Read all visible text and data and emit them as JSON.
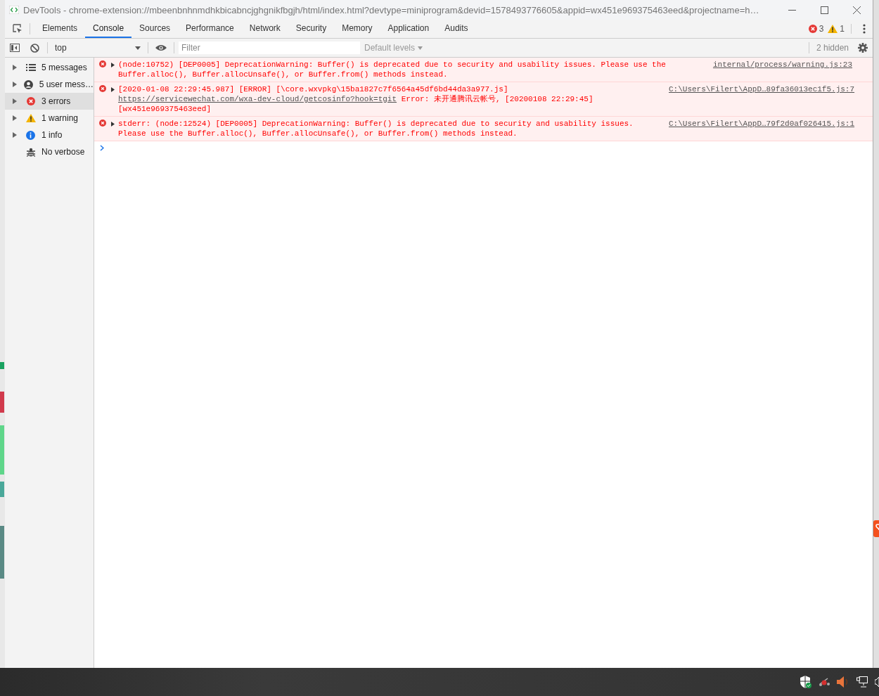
{
  "window": {
    "title": "DevTools - chrome-extension://mbeenbnhnmdhkbicabncjghgnikfbgjh/html/index.html?devtype=miniprogram&devid=1578493776605&appid=wx451e969375463eed&projectname=h…"
  },
  "tabs": [
    {
      "label": "Elements",
      "selected": false
    },
    {
      "label": "Console",
      "selected": true
    },
    {
      "label": "Sources",
      "selected": false
    },
    {
      "label": "Performance",
      "selected": false
    },
    {
      "label": "Network",
      "selected": false
    },
    {
      "label": "Security",
      "selected": false
    },
    {
      "label": "Memory",
      "selected": false
    },
    {
      "label": "Application",
      "selected": false
    },
    {
      "label": "Audits",
      "selected": false
    }
  ],
  "counts": {
    "errors": "3",
    "warnings": "1"
  },
  "toolbar": {
    "context": "top",
    "filter_placeholder": "Filter",
    "levels": "Default levels",
    "hidden": "2 hidden"
  },
  "sidebar": {
    "items": [
      {
        "label": "5 messages",
        "kind": "messages",
        "selected": false
      },
      {
        "label": "5 user mess…",
        "kind": "user",
        "selected": false
      },
      {
        "label": "3 errors",
        "kind": "error",
        "selected": true
      },
      {
        "label": "1 warning",
        "kind": "warning",
        "selected": false
      },
      {
        "label": "1 info",
        "kind": "info",
        "selected": false
      },
      {
        "label": "No verbose",
        "kind": "verbose",
        "selected": false
      }
    ]
  },
  "messages": [
    {
      "kind": "error",
      "parts": [
        {
          "kind": "text",
          "text": "(node:10752) [DEP0005] DeprecationWarning: Buffer() is deprecated due to security and usability issues. Please use the Buffer.alloc(), Buffer.allocUnsafe(), or Buffer.from() methods instead."
        }
      ],
      "source": "internal/process/warning.js:23"
    },
    {
      "kind": "error",
      "parts": [
        {
          "kind": "text",
          "text": "[2020-01-08 22:29:45.987] [ERROR] [\\core.wxvpkg\\15ba1827c7f6564a45df6bd44da3a977.js] "
        },
        {
          "kind": "link",
          "text": "https://servicewechat.com/wxa-dev-cloud/getcosinfo?hook=tgit"
        },
        {
          "kind": "text",
          "text": " Error: 未开通腾讯云帐号, [20200108 22:29:45][wx451e969375463eed]"
        }
      ],
      "source": "C:\\Users\\Filert\\AppD…89fa36013ec1f5.js:7"
    },
    {
      "kind": "error",
      "parts": [
        {
          "kind": "text",
          "text": "stderr: (node:12524) [DEP0005] DeprecationWarning: Buffer() is deprecated due to security and usability issues.\nPlease use the Buffer.alloc(), Buffer.allocUnsafe(), or Buffer.from() methods instead."
        }
      ],
      "source": "C:\\Users\\Filert\\AppD…79f2d0af026415.js:1"
    }
  ]
}
